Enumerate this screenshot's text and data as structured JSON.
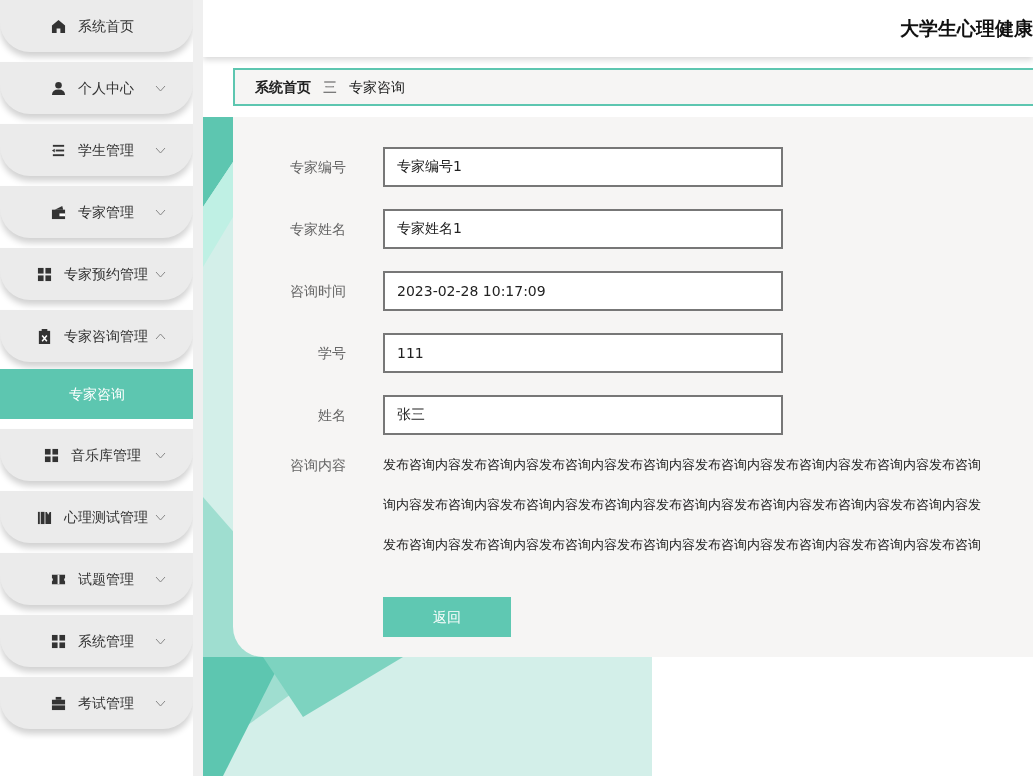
{
  "sidebar": {
    "items": [
      {
        "label": "系统首页"
      },
      {
        "label": "个人中心",
        "expanded": false
      },
      {
        "label": "学生管理",
        "expanded": false
      },
      {
        "label": "专家管理",
        "expanded": false
      },
      {
        "label": "专家预约管理",
        "expanded": false
      },
      {
        "label": "专家咨询管理",
        "expanded": true,
        "children": [
          {
            "label": "专家咨询",
            "selected": true
          }
        ]
      },
      {
        "label": "音乐库管理",
        "expanded": false
      },
      {
        "label": "心理测试管理",
        "expanded": false
      },
      {
        "label": "试题管理",
        "expanded": false
      },
      {
        "label": "系统管理",
        "expanded": false
      },
      {
        "label": "考试管理",
        "expanded": false
      }
    ]
  },
  "header": {
    "title": "大学生心理健康"
  },
  "breadcrumb": {
    "items": [
      {
        "label": "系统首页"
      },
      {
        "label": "专家咨询"
      }
    ],
    "separator": "三"
  },
  "form": {
    "fields": [
      {
        "kind": "input",
        "label": "专家编号",
        "value": "专家编号1"
      },
      {
        "kind": "input",
        "label": "专家姓名",
        "value": "专家姓名1"
      },
      {
        "kind": "input",
        "label": "咨询时间",
        "value": "2023-02-28 10:17:09"
      },
      {
        "kind": "input",
        "label": "学号",
        "value": "111"
      },
      {
        "kind": "input",
        "label": "姓名",
        "value": "张三"
      },
      {
        "kind": "text",
        "label": "咨询内容",
        "lines": [
          "发布咨询内容发布咨询内容发布咨询内容发布咨询内容发布咨询内容发布咨询内容发布咨询内容发布咨询",
          "询内容发布咨询内容发布咨询内容发布咨询内容发布咨询内容发布咨询内容发布咨询内容发布咨询内容发",
          "发布咨询内容发布咨询内容发布咨询内容发布咨询内容发布咨询内容发布咨询内容发布咨询内容发布咨询"
        ]
      }
    ],
    "button": "返回"
  }
}
